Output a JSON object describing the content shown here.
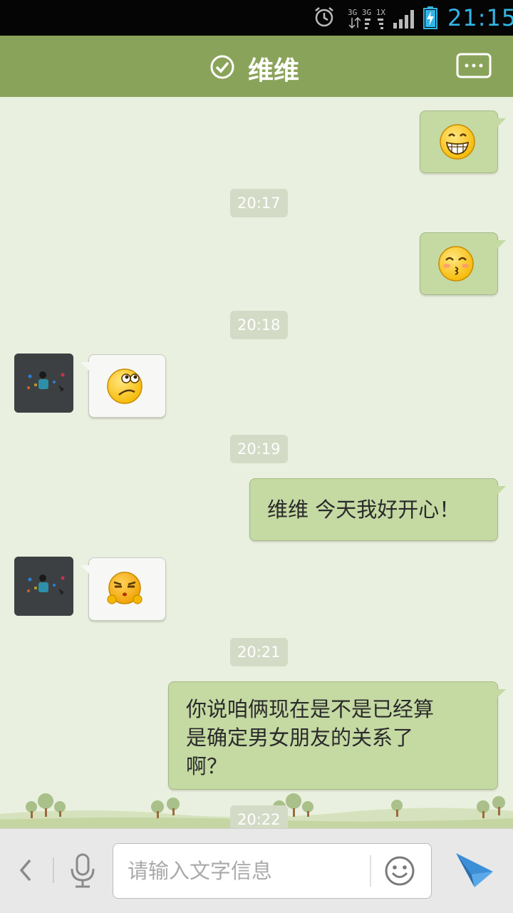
{
  "status_bar": {
    "network_top": "3G 3G 1X G",
    "time": "21:15",
    "icons": [
      "alarm-icon",
      "network-icon",
      "signal-icon",
      "battery-charging-icon"
    ]
  },
  "header": {
    "title": "维维",
    "online_icon": "check-circle-icon",
    "menu_icon": "more-dots-icon",
    "color": "#8aa35a"
  },
  "messages": {
    "m1": {
      "direction": "outgoing",
      "emoji": "grin-emoji"
    },
    "t1": "20:17",
    "m2": {
      "direction": "outgoing",
      "emoji": "kiss-emoji"
    },
    "t2": "20:18",
    "m3": {
      "direction": "incoming",
      "emoji": "confused-emoji"
    },
    "t3": "20:19",
    "m4": {
      "direction": "outgoing",
      "text": "维维 今天我好开心！"
    },
    "m5": {
      "direction": "incoming",
      "emoji": "smug-emoji"
    },
    "t4": "20:21",
    "m6": {
      "direction": "outgoing",
      "line1": "你说咱俩现在是不是已经算",
      "line2": "是确定男女朋友的关系了",
      "line3": "啊？"
    },
    "t5": "20:22"
  },
  "input_bar": {
    "placeholder": "请输入文字信息",
    "icons": [
      "back-chevron-icon",
      "microphone-icon",
      "smiley-icon",
      "send-icon"
    ]
  },
  "colors": {
    "outgoing_bubble": "#c5d9a3",
    "incoming_bubble": "#f7f7f5",
    "background": "#e9f0df",
    "clock": "#33b5e5"
  }
}
